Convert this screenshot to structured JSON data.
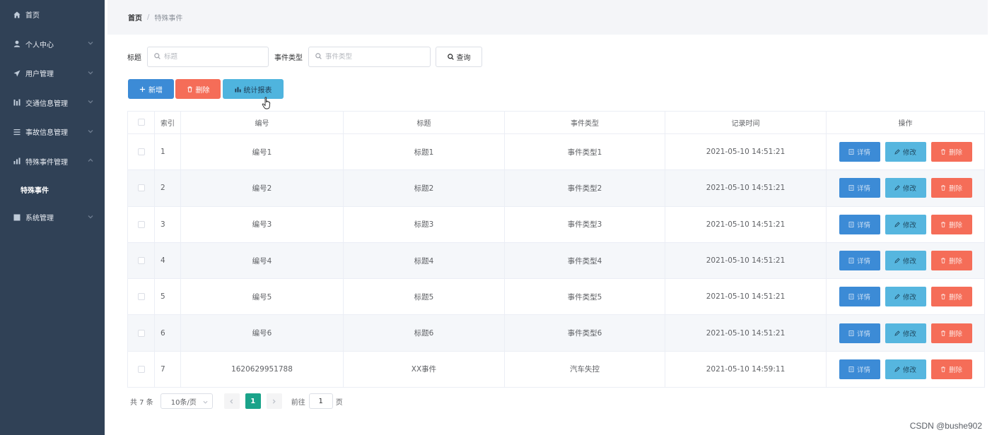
{
  "sidebar": {
    "items": [
      {
        "label": "首页",
        "icon": "home-icon"
      },
      {
        "label": "个人中心",
        "icon": "user-icon"
      },
      {
        "label": "用户管理",
        "icon": "send-icon"
      },
      {
        "label": "交通信息管理",
        "icon": "bar-icon"
      },
      {
        "label": "事故信息管理",
        "icon": "list-icon"
      },
      {
        "label": "特殊事件管理",
        "icon": "chart-icon"
      },
      {
        "label": "系统管理",
        "icon": "picture-icon"
      }
    ],
    "subitem": "特殊事件"
  },
  "breadcrumb": {
    "home": "首页",
    "sep": "/",
    "current": "特殊事件"
  },
  "search": {
    "title_label": "标题",
    "title_placeholder": "标题",
    "type_label": "事件类型",
    "type_placeholder": "事件类型",
    "button": "查询"
  },
  "toolbar": {
    "add": "新增",
    "delete": "删除",
    "chart": "统计报表"
  },
  "table": {
    "headers": [
      "索引",
      "编号",
      "标题",
      "事件类型",
      "记录时间",
      "操作"
    ],
    "rows": [
      {
        "idx": "1",
        "no": "编号1",
        "title": "标题1",
        "type": "事件类型1",
        "time": "2021-05-10 14:51:21"
      },
      {
        "idx": "2",
        "no": "编号2",
        "title": "标题2",
        "type": "事件类型2",
        "time": "2021-05-10 14:51:21"
      },
      {
        "idx": "3",
        "no": "编号3",
        "title": "标题3",
        "type": "事件类型3",
        "time": "2021-05-10 14:51:21"
      },
      {
        "idx": "4",
        "no": "编号4",
        "title": "标题4",
        "type": "事件类型4",
        "time": "2021-05-10 14:51:21"
      },
      {
        "idx": "5",
        "no": "编号5",
        "title": "标题5",
        "type": "事件类型5",
        "time": "2021-05-10 14:51:21"
      },
      {
        "idx": "6",
        "no": "编号6",
        "title": "标题6",
        "type": "事件类型6",
        "time": "2021-05-10 14:51:21"
      },
      {
        "idx": "7",
        "no": "1620629951788",
        "title": "XX事件",
        "type": "汽车失控",
        "time": "2021-05-10 14:59:11"
      }
    ],
    "ops": {
      "detail": "详情",
      "edit": "修改",
      "delete": "删除"
    }
  },
  "pager": {
    "total": "共 7 条",
    "size": "10条/页",
    "page": "1",
    "goto": "前往",
    "goto_value": "1",
    "unit": "页"
  },
  "watermark": "CSDN @bushe902",
  "colors": {
    "sidebar": "#304156",
    "primary": "#3c8bd6",
    "danger": "#f56d58",
    "info": "#56b6df",
    "active_page": "#1aa38a"
  }
}
